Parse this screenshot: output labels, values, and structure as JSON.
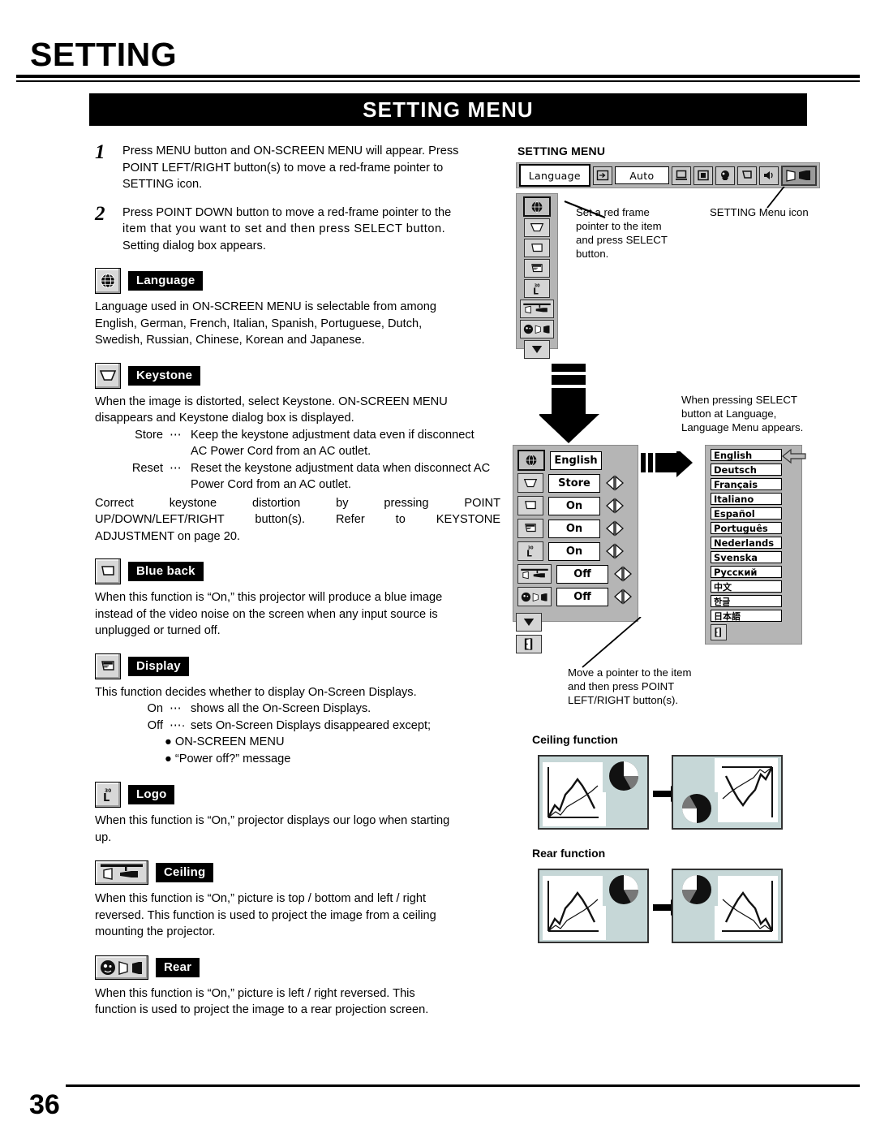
{
  "page": {
    "title": "SETTING",
    "banner": "SETTING MENU",
    "number": "36"
  },
  "steps": [
    {
      "num": "1",
      "lines": [
        "Press MENU button and ON-SCREEN MENU will appear.  Press",
        "POINT LEFT/RIGHT button(s) to move a red-frame pointer to",
        "SETTING icon."
      ]
    },
    {
      "num": "2",
      "lines": [
        "Press POINT DOWN button to move a red-frame pointer to the",
        "item that you want to set and then press SELECT button.",
        "Setting dialog box appears."
      ]
    }
  ],
  "sections": {
    "language": {
      "label": "Language",
      "icon": "globe-icon",
      "lines": [
        "Language used in ON-SCREEN MENU is selectable from among",
        "English, German, French, Italian, Spanish, Portuguese, Dutch,",
        "Swedish, Russian, Chinese, Korean and Japanese."
      ]
    },
    "keystone": {
      "label": "Keystone",
      "icon": "keystone-trapezoid-icon",
      "lines": [
        "When the image is distorted, select Keystone.  ON-SCREEN MENU",
        "disappears and Keystone dialog box is displayed."
      ],
      "subitems": [
        {
          "key": "Store",
          "dots": "⋯",
          "value": "Keep the keystone adjustment data even if disconnect",
          "value2": "AC Power Cord from an AC outlet."
        },
        {
          "key": "Reset",
          "dots": "⋯",
          "value": "Reset the keystone adjustment data when disconnect AC",
          "value2": "Power Cord from an AC outlet."
        }
      ],
      "tail": [
        "Correct keystone distortion by pressing POINT",
        "UP/DOWN/LEFT/RIGHT button(s).  Refer to KEYSTONE",
        "ADJUSTMENT on page 20."
      ]
    },
    "blue_back": {
      "label": "Blue back",
      "icon": "blue-back-screen-icon",
      "lines": [
        "When this function is “On,” this projector will produce a blue image",
        "instead of the video noise on the screen when any input source is",
        "unplugged or turned off."
      ]
    },
    "display": {
      "label": "Display",
      "icon": "display-osd-icon",
      "lines": [
        "This function decides whether to display On-Screen Displays."
      ],
      "subitems": [
        {
          "key": "On",
          "dots": "⋯",
          "value": "shows all the On-Screen Displays."
        },
        {
          "key": "Off",
          "dots": "⋯·",
          "value": "sets On-Screen Displays disappeared except;"
        }
      ],
      "bullets": [
        "ON-SCREEN MENU",
        "“Power off?” message"
      ]
    },
    "logo": {
      "label": "Logo",
      "icon": "logo-icon",
      "icon_text_top": "30",
      "icon_text_main": "L",
      "lines": [
        "When this function is “On,” projector displays our logo when starting",
        "up."
      ]
    },
    "ceiling": {
      "label": "Ceiling",
      "icon": "ceiling-mount-icon",
      "lines": [
        "When this function is “On,” picture is top / bottom and left / right",
        "reversed.  This function is used to project the image from a ceiling",
        "mounting the projector."
      ]
    },
    "rear": {
      "label": "Rear",
      "icon": "rear-projection-icon",
      "lines": [
        "When this function is “On,” picture is left / right reversed.  This",
        "function is used to project the image to a rear projection screen."
      ]
    }
  },
  "right": {
    "menu_heading": "SETTING MENU",
    "menubar": {
      "language_button": "Language",
      "auto_button": "Auto",
      "icons": [
        "input-source-icon",
        "computer-icon",
        "image-select-icon",
        "image-adjust-icon",
        "screen-icon",
        "sound-icon",
        "setting-icon"
      ]
    },
    "callout_pointer": [
      "Set a red frame",
      "pointer to the item",
      "and press SELECT",
      "button."
    ],
    "callout_setting_icon": "SETTING Menu icon",
    "callout_select": [
      "When pressing SELECT",
      "button at Language,",
      "Language Menu appears."
    ],
    "callout_move_pointer": [
      "Move a pointer to the item",
      "and then press POINT",
      "LEFT/RIGHT button(s)."
    ],
    "dialog": {
      "rows": [
        {
          "icon": "globe-icon",
          "value": "English",
          "arrows": false,
          "selected": true
        },
        {
          "icon": "keystone-trapezoid-icon",
          "value": "Store",
          "arrows": true,
          "selected": false
        },
        {
          "icon": "blue-back-screen-icon",
          "value": "On",
          "arrows": true,
          "selected": false
        },
        {
          "icon": "display-osd-icon",
          "value": "On",
          "arrows": true,
          "selected": false
        },
        {
          "icon": "logo-icon",
          "value": "On",
          "arrows": true,
          "selected": false
        },
        {
          "icon": "ceiling-mount-icon",
          "value": "Off",
          "arrows": true,
          "selected": false
        },
        {
          "icon": "rear-projection-icon",
          "value": "Off",
          "arrows": true,
          "selected": false
        }
      ],
      "scroll_down_icon": "scroll-down-icon",
      "quit_icon": "quit-door-icon"
    },
    "sidebar_icons": [
      "globe-icon",
      "keystone-trapezoid-icon",
      "blue-back-screen-icon",
      "display-osd-icon",
      "logo-icon",
      "ceiling-mount-icon",
      "rear-projection-icon",
      "scroll-down-icon"
    ],
    "languages": [
      "English",
      "Deutsch",
      "Français",
      "Italiano",
      "Español",
      "Português",
      "Nederlands",
      "Svenska",
      "Русский",
      "中文",
      "한글",
      "日本語"
    ],
    "ceiling_function_title": "Ceiling function",
    "rear_function_title": "Rear function"
  },
  "colors": {
    "panel_gray": "#b5b5b5",
    "chip_gray": "#d8d8d8",
    "screen_teal": "#c6d7d7",
    "ink": "#000000"
  }
}
